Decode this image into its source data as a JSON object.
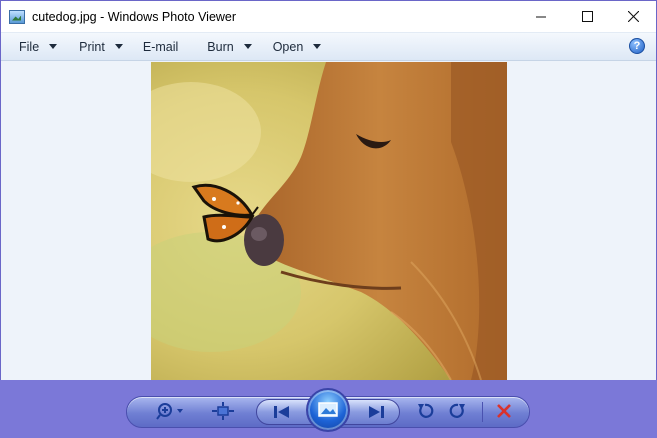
{
  "window": {
    "title": "cutedog.jpg - Windows Photo Viewer",
    "icon": "photo-viewer-app-icon"
  },
  "caption_buttons": [
    "minimize-icon",
    "maximize-icon",
    "close-icon"
  ],
  "menu": {
    "items": [
      {
        "label": "File",
        "has_arrow": true
      },
      {
        "label": "Print",
        "has_arrow": true
      },
      {
        "label": "E-mail",
        "has_arrow": false
      },
      {
        "label": "Burn",
        "has_arrow": true
      },
      {
        "label": "Open",
        "has_arrow": true
      }
    ],
    "help_icon": "help-icon",
    "help_glyph": "?"
  },
  "image": {
    "description_icon": "photo-dog-butterfly"
  },
  "toolbar": {
    "buttons": [
      "zoom-icon",
      "actual-size-icon",
      "previous-icon",
      "slideshow-icon",
      "next-icon",
      "rotate-counterclockwise-icon",
      "rotate-clockwise-icon",
      "delete-icon"
    ]
  },
  "colors": {
    "toolbar_bg": "#7b78d8",
    "viewer_bg": "#eef3fa",
    "delete_red": "#d9322c"
  }
}
